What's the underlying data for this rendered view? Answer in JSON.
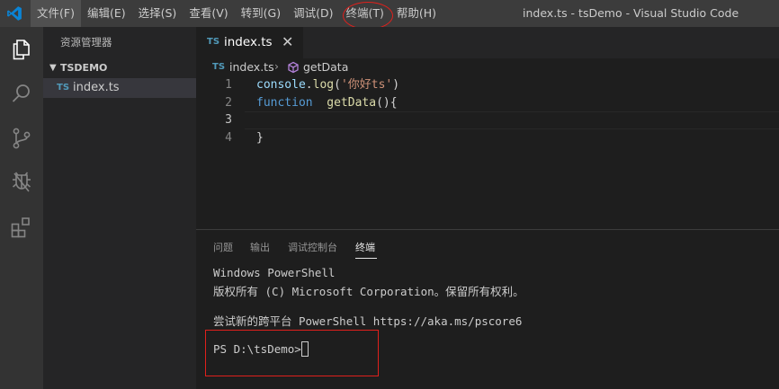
{
  "window": {
    "title": "index.ts - tsDemo - Visual Studio Code",
    "logo_icon": "vscode-logo-icon"
  },
  "menu": [
    "文件(F)",
    "编辑(E)",
    "选择(S)",
    "查看(V)",
    "转到(G)",
    "调试(D)",
    "终端(T)",
    "帮助(H)"
  ],
  "activity_bar": [
    "files-icon",
    "search-icon",
    "source-control-icon",
    "debug-icon",
    "extensions-icon"
  ],
  "sidebar": {
    "title": "资源管理器",
    "folder": "TSDEMO",
    "file_badge": "TS",
    "files": [
      "index.ts"
    ]
  },
  "editor": {
    "tab_label": "index.ts",
    "tab_badge": "TS",
    "tab_close": "✕",
    "breadcrumb_file": "index.ts",
    "breadcrumb_symbol": "getData",
    "line_numbers": [
      "1",
      "2",
      "3",
      "4"
    ],
    "lines": {
      "l1_obj": "console",
      "l1_dot": ".",
      "l1_method": "log",
      "l1_open": "(",
      "l1_str": "'你好ts'",
      "l1_close": ")",
      "l2_kw": "function",
      "l2_name": "getData",
      "l2_rest": "(){",
      "l4": "}"
    }
  },
  "panel": {
    "tabs": [
      "问题",
      "输出",
      "调试控制台",
      "终端"
    ],
    "active_tab": "终端",
    "terminal_lines": [
      "Windows PowerShell",
      "版权所有 (C) Microsoft Corporation。保留所有权利。",
      "",
      "尝试新的跨平台 PowerShell https://aka.ms/pscore6",
      "",
      "PS D:\\tsDemo> "
    ]
  },
  "colors": {
    "accent": "#007acc",
    "annotation": "#e0201c",
    "ts_badge": "#519aba"
  }
}
